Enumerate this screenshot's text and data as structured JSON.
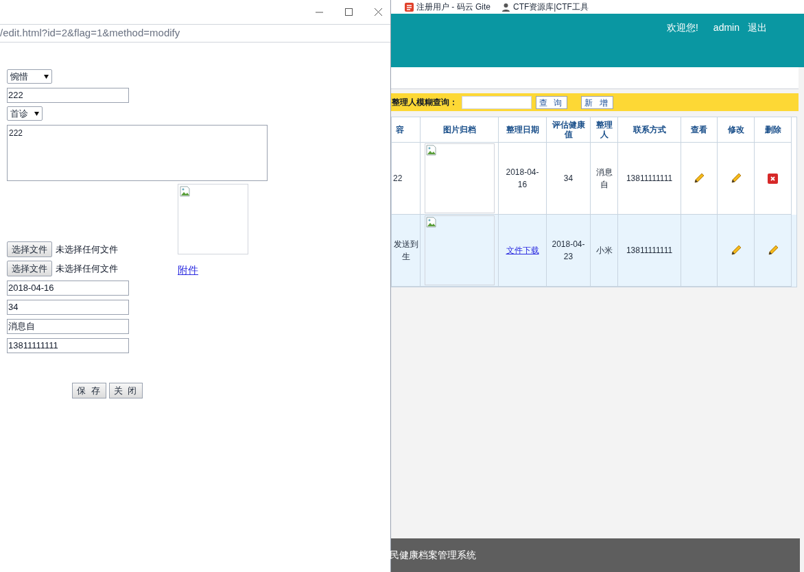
{
  "popup": {
    "url": "/edit.html?id=2&flag=1&method=modify",
    "form": {
      "select_1": "惋惜",
      "text_1": "222",
      "select_2": "首诊",
      "textarea": "222",
      "file_inputs": [
        {
          "button": "选择文件",
          "status": "未选择任何文件"
        },
        {
          "button": "选择文件",
          "status": "未选择任何文件"
        }
      ],
      "attachment_link": "附件",
      "fields": [
        "2018-04-16",
        "34",
        "消息自",
        "13811111111"
      ],
      "buttons": [
        "保 存",
        "关 闭"
      ]
    }
  },
  "bookmarks": [
    {
      "label": "注册用户 - 码云 Gite"
    },
    {
      "label": "CTF资源库|CTF工具"
    }
  ],
  "header": {
    "welcome": "欢迎您!",
    "user": "admin",
    "logout": "退出"
  },
  "search": {
    "label": "整理人模糊查询：",
    "buttons": [
      "查 询",
      "新 增"
    ]
  },
  "table": {
    "columns": [
      "容",
      "图片归档",
      "整理日期",
      "评估健康值",
      "整理人",
      "联系方式",
      "查看",
      "修改",
      "删除"
    ],
    "rows": [
      {
        "selected": false,
        "cells": [
          {
            "kind": "text",
            "text": "22"
          },
          {
            "kind": "image"
          },
          {
            "kind": "text",
            "text": "2018-04-16"
          },
          {
            "kind": "text",
            "text": "34"
          },
          {
            "kind": "text",
            "text": "消息自"
          },
          {
            "kind": "text",
            "text": "13811111111"
          },
          {
            "kind": "pencil"
          },
          {
            "kind": "pencil"
          },
          {
            "kind": "delete"
          }
        ]
      },
      {
        "selected": true,
        "cells": [
          {
            "kind": "text",
            "text": "发送到生"
          },
          {
            "kind": "image"
          },
          {
            "kind": "link",
            "text": "文件下载"
          },
          {
            "kind": "text",
            "text": "2018-04-23"
          },
          {
            "kind": "text",
            "text": "小米"
          },
          {
            "kind": "text",
            "text": "13811111111"
          },
          {
            "kind": "empty"
          },
          {
            "kind": "pencil"
          },
          {
            "kind": "pencil"
          }
        ]
      }
    ]
  },
  "footer": {
    "text": "民健康档案管理系统"
  }
}
